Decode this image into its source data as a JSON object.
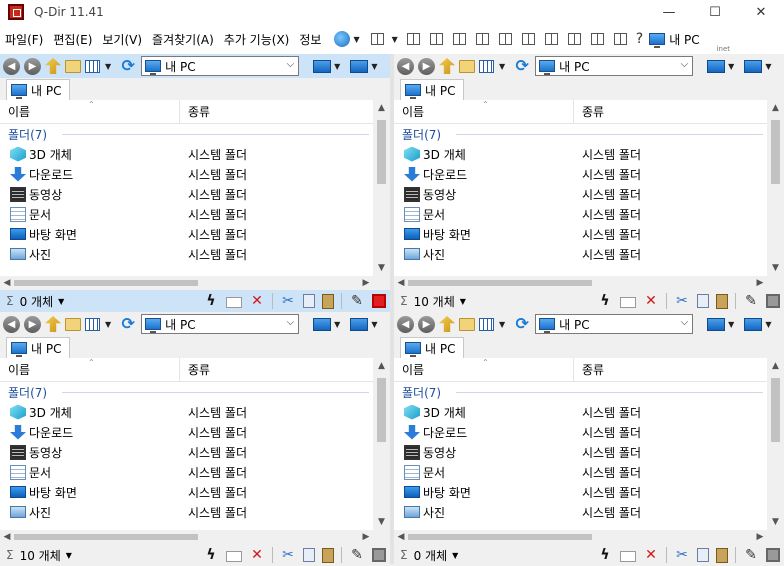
{
  "window": {
    "title": "Q-Dir 11.41",
    "minimize": "—",
    "maximize": "☐",
    "close": "✕"
  },
  "menu": {
    "items": [
      "파일(F)",
      "편집(E)",
      "보기(V)",
      "즐겨찾기(A)",
      "추가 기능(X)",
      "정보"
    ],
    "info_sub": "inet",
    "pc_label": "내 PC"
  },
  "panes": [
    {
      "active": true,
      "address": "내 PC",
      "tab": "내 PC",
      "columns": {
        "name": "이름",
        "type": "종류"
      },
      "group": "폴더(7)",
      "rows": [
        {
          "name": "3D 개체",
          "type": "시스템 폴더",
          "icon": "cube-icon"
        },
        {
          "name": "다운로드",
          "type": "시스템 폴더",
          "icon": "download-icon"
        },
        {
          "name": "동영상",
          "type": "시스템 폴더",
          "icon": "video-icon"
        },
        {
          "name": "문서",
          "type": "시스템 폴더",
          "icon": "document-icon"
        },
        {
          "name": "바탕 화면",
          "type": "시스템 폴더",
          "icon": "desktop-icon"
        },
        {
          "name": "사진",
          "type": "시스템 폴더",
          "icon": "picture-icon"
        }
      ],
      "status": "0 개체"
    },
    {
      "active": false,
      "address": "내 PC",
      "tab": "내 PC",
      "columns": {
        "name": "이름",
        "type": "종류"
      },
      "group": "폴더(7)",
      "rows": [
        {
          "name": "3D 개체",
          "type": "시스템 폴더",
          "icon": "cube-icon"
        },
        {
          "name": "다운로드",
          "type": "시스템 폴더",
          "icon": "download-icon"
        },
        {
          "name": "동영상",
          "type": "시스템 폴더",
          "icon": "video-icon"
        },
        {
          "name": "문서",
          "type": "시스템 폴더",
          "icon": "document-icon"
        },
        {
          "name": "바탕 화면",
          "type": "시스템 폴더",
          "icon": "desktop-icon"
        },
        {
          "name": "사진",
          "type": "시스템 폴더",
          "icon": "picture-icon"
        }
      ],
      "status": "10 개체"
    },
    {
      "active": false,
      "address": "내 PC",
      "tab": "내 PC",
      "columns": {
        "name": "이름",
        "type": "종류"
      },
      "group": "폴더(7)",
      "rows": [
        {
          "name": "3D 개체",
          "type": "시스템 폴더",
          "icon": "cube-icon"
        },
        {
          "name": "다운로드",
          "type": "시스템 폴더",
          "icon": "download-icon"
        },
        {
          "name": "동영상",
          "type": "시스템 폴더",
          "icon": "video-icon"
        },
        {
          "name": "문서",
          "type": "시스템 폴더",
          "icon": "document-icon"
        },
        {
          "name": "바탕 화면",
          "type": "시스템 폴더",
          "icon": "desktop-icon"
        },
        {
          "name": "사진",
          "type": "시스템 폴더",
          "icon": "picture-icon"
        }
      ],
      "status": "10 개체"
    },
    {
      "active": false,
      "address": "내 PC",
      "tab": "내 PC",
      "columns": {
        "name": "이름",
        "type": "종류"
      },
      "group": "폴더(7)",
      "rows": [
        {
          "name": "3D 개체",
          "type": "시스템 폴더",
          "icon": "cube-icon"
        },
        {
          "name": "다운로드",
          "type": "시스템 폴더",
          "icon": "download-icon"
        },
        {
          "name": "동영상",
          "type": "시스템 폴더",
          "icon": "video-icon"
        },
        {
          "name": "문서",
          "type": "시스템 폴더",
          "icon": "document-icon"
        },
        {
          "name": "바탕 화면",
          "type": "시스템 폴더",
          "icon": "desktop-icon"
        },
        {
          "name": "사진",
          "type": "시스템 폴더",
          "icon": "picture-icon"
        }
      ],
      "status": "0 개체"
    }
  ],
  "colors": {
    "active_bar": "#cde3f7",
    "accent": "#1e4e9c",
    "delete_red": "#d01818"
  }
}
